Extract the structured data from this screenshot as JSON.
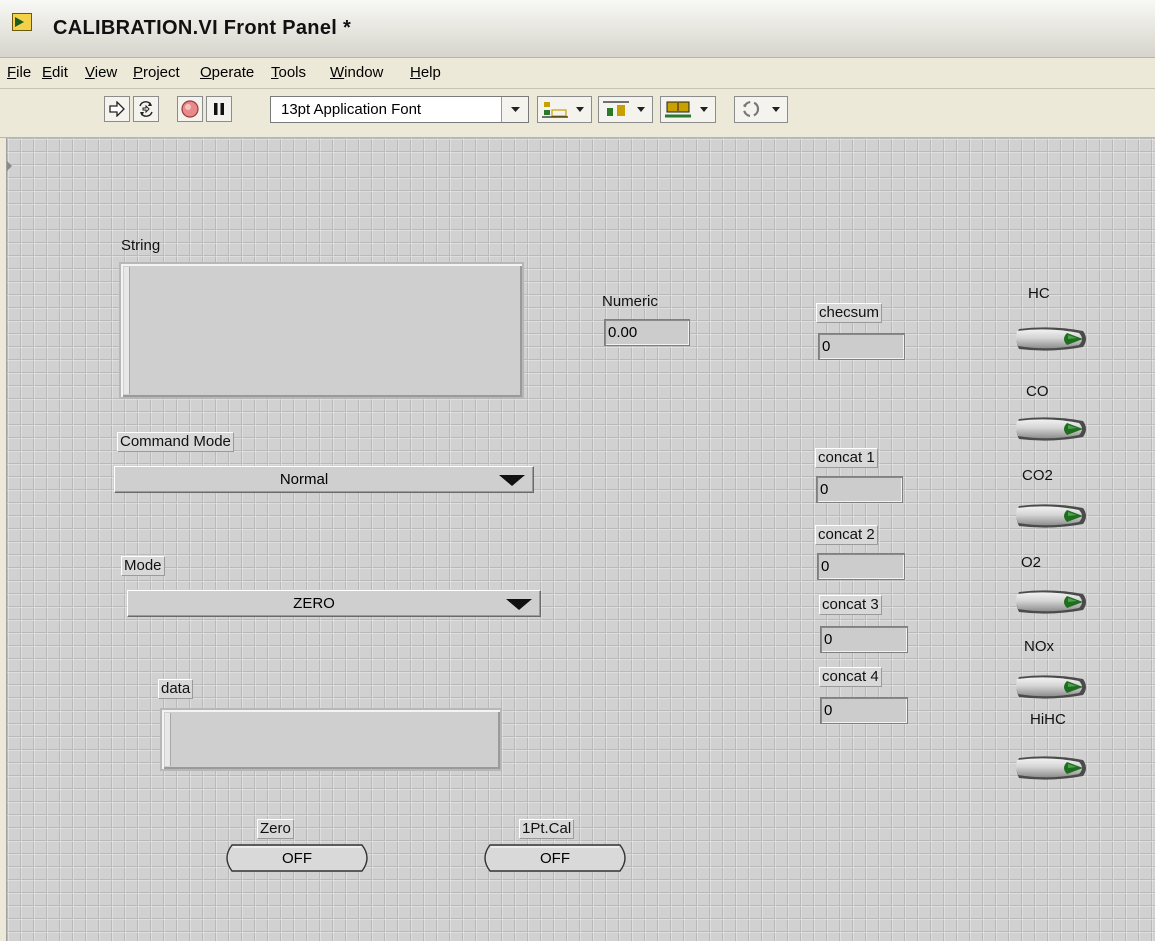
{
  "window": {
    "title": "CALIBRATION.VI Front Panel *"
  },
  "menu": [
    "File",
    "Edit",
    "View",
    "Project",
    "Operate",
    "Tools",
    "Window",
    "Help"
  ],
  "menu_underline": [
    "F",
    "E",
    "V",
    "P",
    "O",
    "T",
    "W",
    "H"
  ],
  "toolbar": {
    "font_select": "13pt Application Font",
    "icons": [
      "run-arrow-icon",
      "run-continuously-icon",
      "abort-icon",
      "pause-icon",
      "align-objects-icon",
      "distribute-objects-icon",
      "resize-objects-icon",
      "reorder-icon"
    ]
  },
  "panel": {
    "string": {
      "label": "String",
      "value": ""
    },
    "command_mode": {
      "label": "Command Mode",
      "value": "Normal"
    },
    "mode": {
      "label": "Mode",
      "value": "ZERO"
    },
    "data": {
      "label": "data",
      "value": ""
    },
    "numeric": {
      "label": "Numeric",
      "value": "0.00"
    },
    "checksum": {
      "label": "checsum",
      "value": "0"
    },
    "concat1": {
      "label": "concat 1",
      "value": "0"
    },
    "concat2": {
      "label": "concat 2",
      "value": "0"
    },
    "concat3": {
      "label": "concat 3",
      "value": "0"
    },
    "concat4": {
      "label": "concat 4",
      "value": "0"
    },
    "zero_button": {
      "label": "Zero",
      "state": "OFF"
    },
    "cal_button": {
      "label": "1Pt.Cal",
      "state": "OFF"
    },
    "leds": [
      {
        "label": "HC"
      },
      {
        "label": "CO"
      },
      {
        "label": "CO2"
      },
      {
        "label": "O2"
      },
      {
        "label": "NOx"
      },
      {
        "label": "HiHC"
      }
    ],
    "led_color": "#1f6e1f"
  }
}
